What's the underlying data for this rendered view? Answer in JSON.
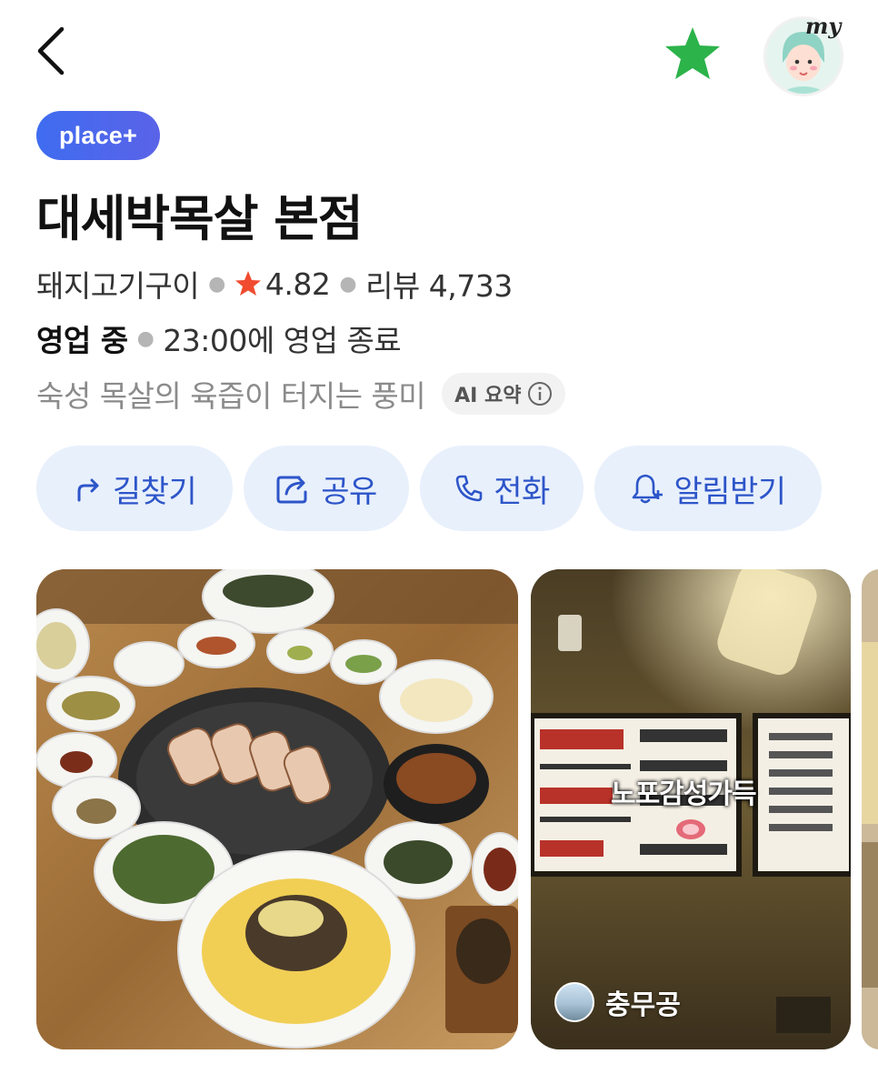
{
  "header": {
    "avatar_label": "my",
    "colors": {
      "favorite": "#2cb34a",
      "back": "#111111"
    }
  },
  "badge": {
    "label": "place+"
  },
  "place": {
    "name": "대세박목살 본점",
    "category": "돼지고기구이",
    "rating": "4.82",
    "reviews": "리뷰 4,733",
    "status": "영업 중",
    "hours": "23:00에 영업 종료",
    "summary": "숙성 목살의 육즙이 터지는 풍미",
    "ai_label": "AI 요약"
  },
  "actions": [
    {
      "label": "길찾기",
      "icon": "directions-icon"
    },
    {
      "label": "공유",
      "icon": "share-icon"
    },
    {
      "label": "전화",
      "icon": "phone-icon"
    },
    {
      "label": "알림받기",
      "icon": "bell-plus-icon"
    }
  ],
  "photos": [
    {
      "subject": "grilled pork neck table spread"
    },
    {
      "subject": "restaurant menu wall",
      "overlay_text": "노포감성가득",
      "author": "충무공"
    },
    {
      "subject": "partial photo"
    }
  ],
  "colors": {
    "accent": "#2d55c9",
    "chip_bg": "#e8f0fc",
    "star": "#f04b2f",
    "badge": "#4a68ee"
  }
}
